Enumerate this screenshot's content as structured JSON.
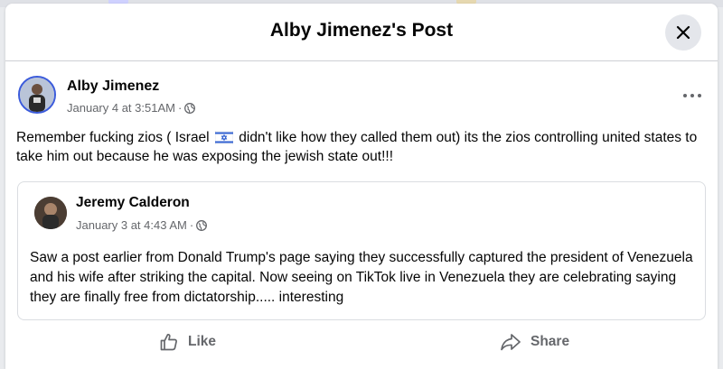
{
  "dialog": {
    "title": "Alby Jimenez's Post"
  },
  "post": {
    "author": "Alby Jimenez",
    "time": "January 4 at 3:51AM",
    "separator": "·",
    "text_before_flag": "Remember fucking zios ( Israel",
    "text_after_flag": "didn't like how they called them out) its the zios controlling united states to take him out because he was exposing the jewish state out!!!"
  },
  "shared_post": {
    "author": "Jeremy Calderon",
    "time": "January 3 at 4:43 AM",
    "separator": "·",
    "text": "Saw a post earlier from Donald Trump's page saying they successfully captured the president of Venezuela and his wife after striking the capital. Now seeing on TikTok live in Venezuela they are celebrating saying they are finally free from dictatorship..... interesting"
  },
  "actions": {
    "like_label": "Like",
    "share_label": "Share"
  },
  "icons": {
    "close": "close-icon",
    "more": "more-horizontal-icon",
    "privacy": "globe-icon",
    "flag": "israel-flag-icon",
    "like": "thumbs-up-icon",
    "share": "share-arrow-icon"
  },
  "colors": {
    "text_primary": "#050505",
    "text_secondary": "#65676b",
    "divider": "#ced0d4",
    "avatar_ring": "#3b5bdb"
  }
}
